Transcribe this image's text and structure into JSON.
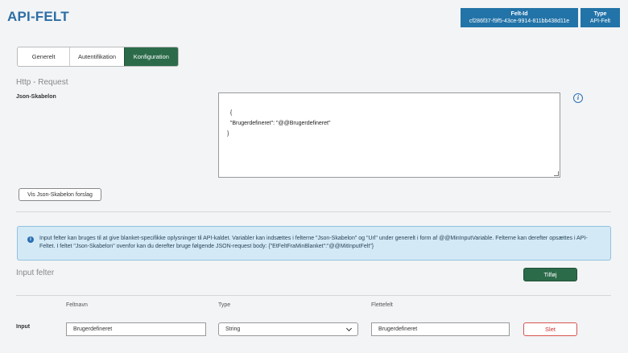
{
  "header": {
    "title": "API-FELT",
    "felt_id_label": "Felt-Id",
    "felt_id_value": "cf286f37-f9f5-43ce-9914-811bb438d11e",
    "type_label": "Type",
    "type_value": "API-Felt"
  },
  "tabs": [
    {
      "label": "Generelt",
      "active": false
    },
    {
      "label": "Autentifikation",
      "active": false
    },
    {
      "label": "Konfiguration",
      "active": true
    }
  ],
  "http_request": {
    "heading": "Http - Request",
    "json_label": "Json-Skabelon",
    "json_value": "{\n  \"Brugerdefineret\": \"@@Brugerdefineret\"\n}",
    "info_glyph": "i",
    "suggest_button": "Vis Json-Skabelon forslag"
  },
  "alert": {
    "icon": "info-icon",
    "glyph": "i",
    "text": "Input felter kan bruges til at give blanket-specifikke oplysninger til API-kaldet. Variabler kan indsættes i felterne \"Json-Skabelon\" og \"Url\" under generelt i form af @@MinInputVariable. Felterne kan derefter opsættes i API-Feltet. I feltet \"Json-Skabelon\" ovenfor kan du derefter bruge følgende JSON-request body: {\"EtFeltFraMinBlanket\":\"@@MitInputFelt\"}"
  },
  "input_fields": {
    "heading": "Input felter",
    "add_button": "Tilføj",
    "columns": [
      "Feltnavn",
      "Type",
      "Flettefelt"
    ],
    "rows": [
      {
        "label": "Input",
        "feltnavn": "Brugerdefineret",
        "type": "String",
        "flettefelt": "Brugerdefineret",
        "delete": "Slet"
      }
    ]
  },
  "colors": {
    "brand_blue": "#2273a8",
    "primary_green": "#2c6b4a",
    "danger_red": "#d9534f",
    "alert_bg": "#d4e9f6"
  }
}
